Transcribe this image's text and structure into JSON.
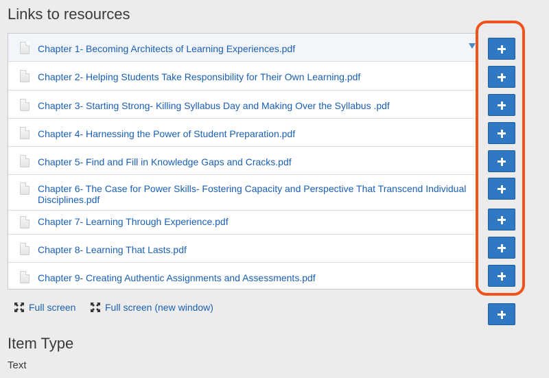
{
  "section": {
    "title": "Links to resources"
  },
  "resources": [
    {
      "label": "Chapter 1- Becoming Architects of Learning Experiences.pdf"
    },
    {
      "label": "Chapter 2- Helping Students Take Responsibility for Their Own Learning.pdf"
    },
    {
      "label": "Chapter 3- Starting Strong- Killing Syllabus Day and Making Over the Syllabus .pdf"
    },
    {
      "label": "Chapter 4- Harnessing the Power of Student Preparation.pdf"
    },
    {
      "label": "Chapter 5- Find and Fill in Knowledge Gaps and Cracks.pdf"
    },
    {
      "label": "Chapter 6- The Case for Power Skills- Fostering Capacity and Perspective That Transcend Individual Disciplines.pdf"
    },
    {
      "label": "Chapter 7- Learning Through Experience.pdf"
    },
    {
      "label": "Chapter 8- Learning That Lasts.pdf"
    },
    {
      "label": "Chapter 9- Creating Authentic Assignments and Assessments.pdf"
    }
  ],
  "fullscreen": {
    "label": "Full screen",
    "new_window_label": "Full screen (new window)"
  },
  "item_type": {
    "title": "Item Type",
    "value": "Text"
  },
  "colors": {
    "link": "#1a5fb4",
    "button": "#2f78c4",
    "highlight": "#f0531c"
  },
  "icons": {
    "resource": "document-icon",
    "add": "plus-icon",
    "fullscreen": "fullscreen-icon",
    "dropdown": "caret-down-icon"
  }
}
